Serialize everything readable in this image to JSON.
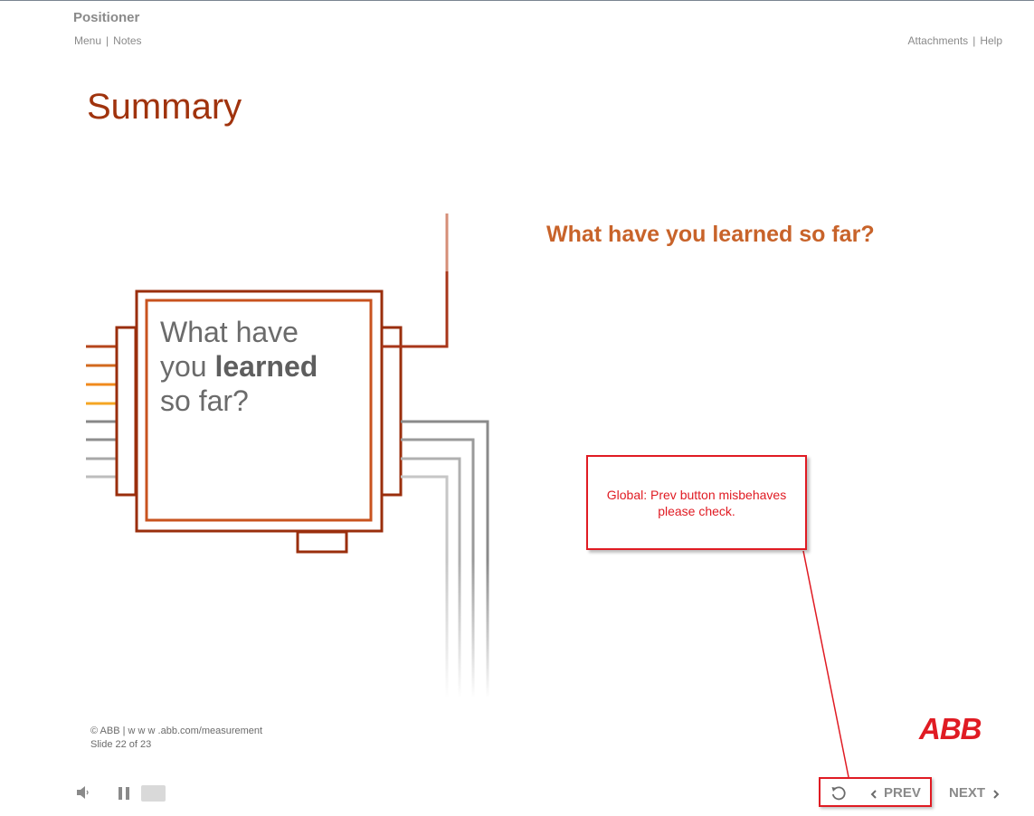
{
  "header": {
    "app_title": "Positioner",
    "menu_label": "Menu",
    "notes_label": "Notes",
    "attachments_label": "Attachments",
    "help_label": "Help"
  },
  "slide": {
    "title": "Summary",
    "question": "What have you learned so far?",
    "chip_text": {
      "line1": "What have",
      "line2_plain": "you ",
      "line2_bold": "learned",
      "line3": "so far?"
    }
  },
  "callout": {
    "line1": "Global: Prev button misbehaves",
    "line2": "please check."
  },
  "footer": {
    "copyright": "© ABB | w w w .abb.com/measurement",
    "slide_counter": "Slide 22 of 23",
    "logo": "ABB"
  },
  "player": {
    "prev_label": "PREV",
    "next_label": "NEXT",
    "icons": [
      "volume-icon",
      "pause-icon",
      "replay-icon",
      "chevron-left-icon",
      "chevron-right-icon"
    ]
  },
  "colors": {
    "title": "#a0330d",
    "question": "#c8632a",
    "callout": "#e01b23",
    "logo": "#e01b23",
    "muted": "#8a8a8a"
  }
}
